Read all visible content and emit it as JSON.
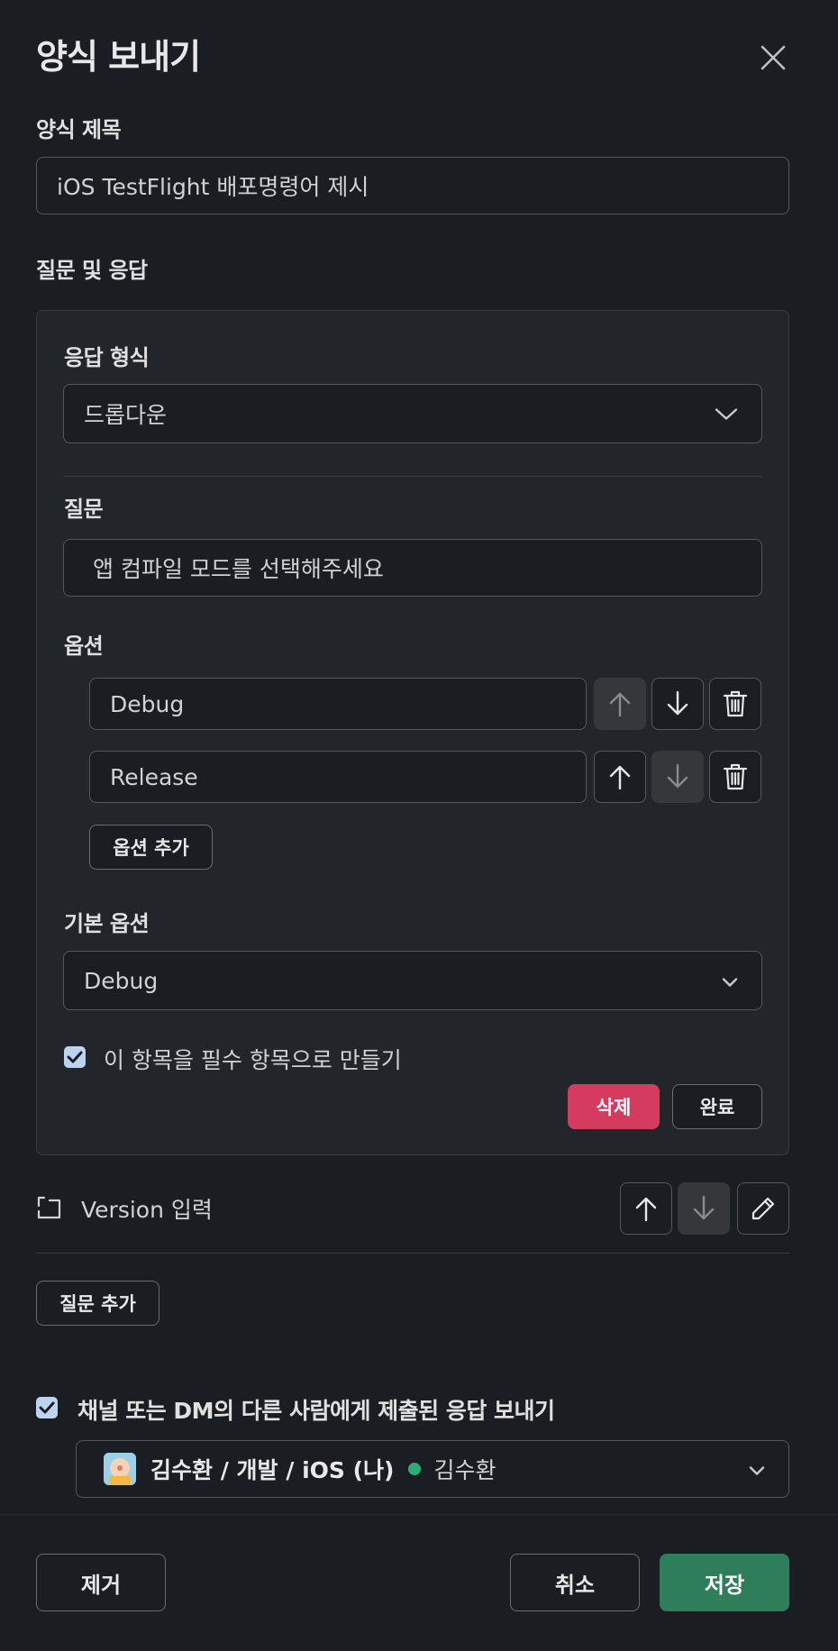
{
  "modal": {
    "title": "양식 보내기"
  },
  "form_title": {
    "label": "양식 제목",
    "value": "iOS TestFlight 배포명령어 제시"
  },
  "qa_section": {
    "label": "질문 및 응답"
  },
  "question_card": {
    "response_type_label": "응답 형식",
    "response_type_value": "드롭다운",
    "question_label": "질문",
    "question_value": "앱 컴파일 모드를 선택해주세요",
    "options_label": "옵션",
    "options": [
      "Debug",
      "Release"
    ],
    "add_option_label": "옵션 추가",
    "default_option_label": "기본 옵션",
    "default_option_value": "Debug",
    "required_label": "이 항목을 필수 항목으로 만들기",
    "required_checked": true,
    "delete_label": "삭제",
    "done_label": "완료"
  },
  "collapsed_question": {
    "label": "Version 입력"
  },
  "add_question_label": "질문 추가",
  "share_responses": {
    "label": "채널 또는 DM의 다른 사람에게 제출된 응답 보내기",
    "checked": true,
    "recipient_channel": "김수환 / 개발 / iOS (나)",
    "recipient_name": "김수환",
    "presence_color": "#2bac76"
  },
  "footer": {
    "remove_label": "제거",
    "cancel_label": "취소",
    "save_label": "저장"
  },
  "colors": {
    "background": "#1a1d21",
    "card": "#222529",
    "danger": "#d53a5f",
    "primary": "#2e7d5b",
    "checkbox": "#bcd4f0"
  }
}
